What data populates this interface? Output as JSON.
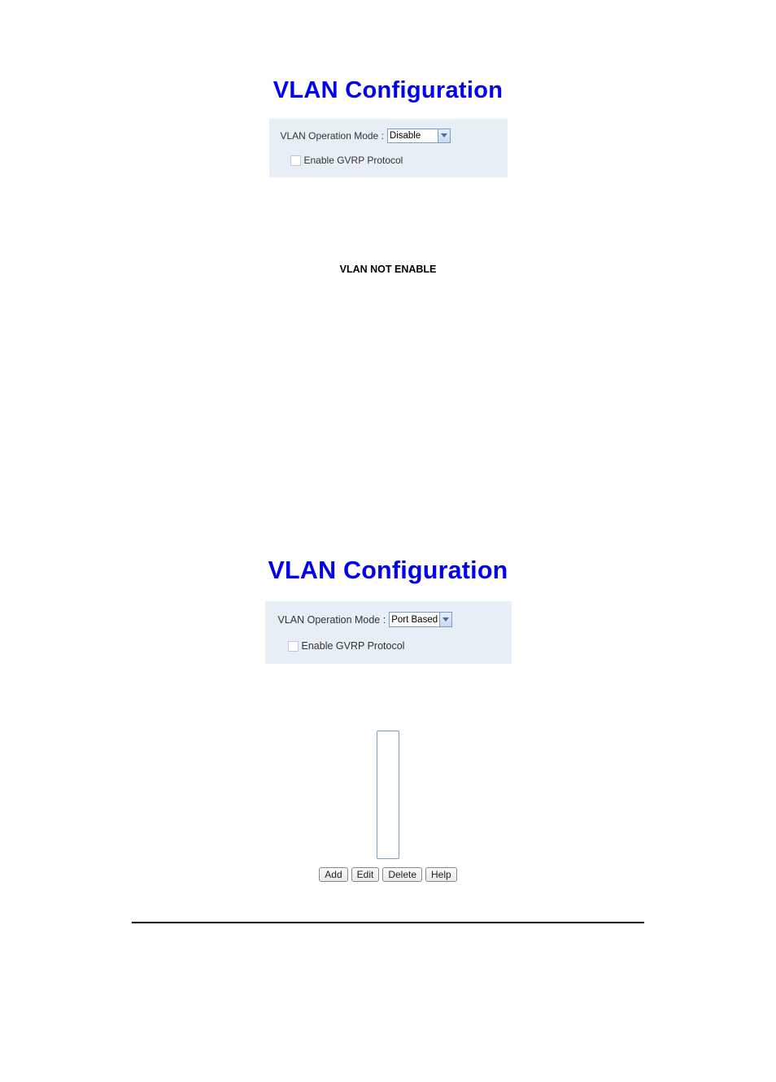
{
  "section1": {
    "title": "VLAN Configuration",
    "mode_label": "VLAN Operation Mode :",
    "mode_value": "Disable",
    "gvrp_label": "Enable GVRP Protocol",
    "status_text": "VLAN NOT ENABLE"
  },
  "section2": {
    "title": "VLAN Configuration",
    "mode_label": "VLAN Operation Mode :",
    "mode_value": "Port Based",
    "gvrp_label": "Enable GVRP Protocol",
    "buttons": {
      "add": "Add",
      "edit": "Edit",
      "delete": "Delete",
      "help": "Help"
    }
  }
}
